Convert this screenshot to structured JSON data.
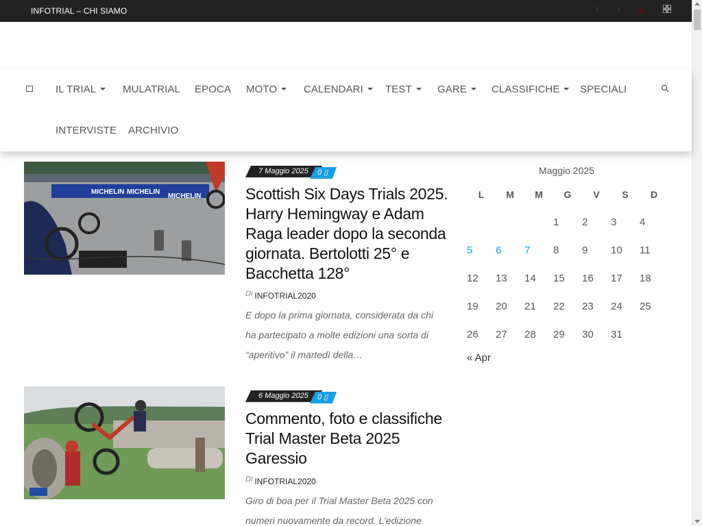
{
  "topbar": {
    "link": "INFOTRIAL – CHI SIAMO",
    "icons": [
      "facebook-icon",
      "twitter-icon",
      "youtube-icon",
      "rss-icon"
    ]
  },
  "nav": {
    "row1": [
      {
        "label": "IL TRIAL",
        "dropdown": true
      },
      {
        "label": "MULATRIAL",
        "dropdown": false
      },
      {
        "label": "EPOCA",
        "dropdown": false
      },
      {
        "label": "MOTO",
        "dropdown": true
      },
      {
        "label": "CALENDARI",
        "dropdown": true
      },
      {
        "label": "TEST",
        "dropdown": true
      },
      {
        "label": "GARE",
        "dropdown": true
      },
      {
        "label": "CLASSIFICHE",
        "dropdown": true
      },
      {
        "label": "SPECIALI",
        "dropdown": false
      }
    ],
    "row2": [
      {
        "label": "INTERVISTE",
        "dropdown": false
      },
      {
        "label": "ARCHIVIO",
        "dropdown": false
      }
    ]
  },
  "posts": [
    {
      "date": "7 Maggio 2025",
      "comments": "0",
      "title": "Scottish Six Days Trials 2025. Harry Hemingway e Adam Raga leader dopo la seconda giornata. Bertolotti 25° e Bacchetta 128°",
      "by": "Di",
      "author": "INFOTRIAL2020",
      "excerpt": "E dopo la prima giornata, considerata da chi ha partecipato a molte edizioni una sorta di “aperitivo” il martedì della…",
      "banners": [
        "MICHELIN",
        "MICHELIN",
        "MICHELIN"
      ]
    },
    {
      "date": "6 Maggio 2025",
      "comments": "0",
      "title": "Commento, foto e classifiche Trial Master Beta 2025 Garessio",
      "by": "Di",
      "author": "INFOTRIAL2020",
      "excerpt": "Giro di boa per il Trial Master Beta 2025 con numeri nuovamente da record. L’edizione"
    }
  ],
  "calendar": {
    "caption": "Maggio 2025",
    "headers": [
      "L",
      "M",
      "M",
      "G",
      "V",
      "S",
      "D"
    ],
    "weeks": [
      [
        "",
        "",
        "",
        "1",
        "2",
        "3",
        "4"
      ],
      [
        "5",
        "6",
        "7",
        "8",
        "9",
        "10",
        "11"
      ],
      [
        "12",
        "13",
        "14",
        "15",
        "16",
        "17",
        "18"
      ],
      [
        "19",
        "20",
        "21",
        "22",
        "23",
        "24",
        "25"
      ],
      [
        "26",
        "27",
        "28",
        "29",
        "30",
        "31",
        ""
      ]
    ],
    "linked_days": [
      "5",
      "6",
      "7"
    ],
    "prev_link": "« Apr"
  },
  "colors": {
    "topbar": "#222222",
    "accent": "#1a9ee2",
    "title": "#111111",
    "date_tag": "#222222"
  }
}
